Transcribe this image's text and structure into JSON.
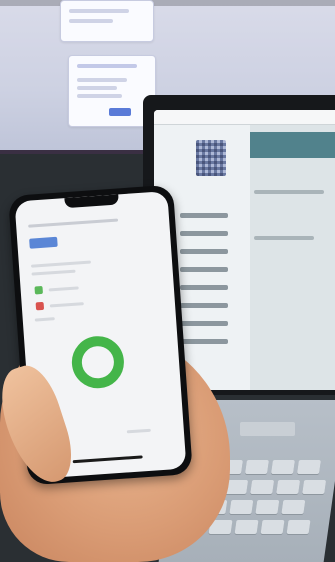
{
  "scene": {
    "description_visible_text": []
  },
  "colors": {
    "monitor_bg": "#d9dbe9",
    "laptop_header": "#51828c",
    "phone_accent_blue": "#5a86d6",
    "ring_green": "#44b549",
    "skin": "#d99b74"
  },
  "icons": {
    "phone_icons": [
      "green-square-icon",
      "red-square-icon"
    ],
    "laptop_sidebar_icons": [
      "dot-icon"
    ]
  }
}
